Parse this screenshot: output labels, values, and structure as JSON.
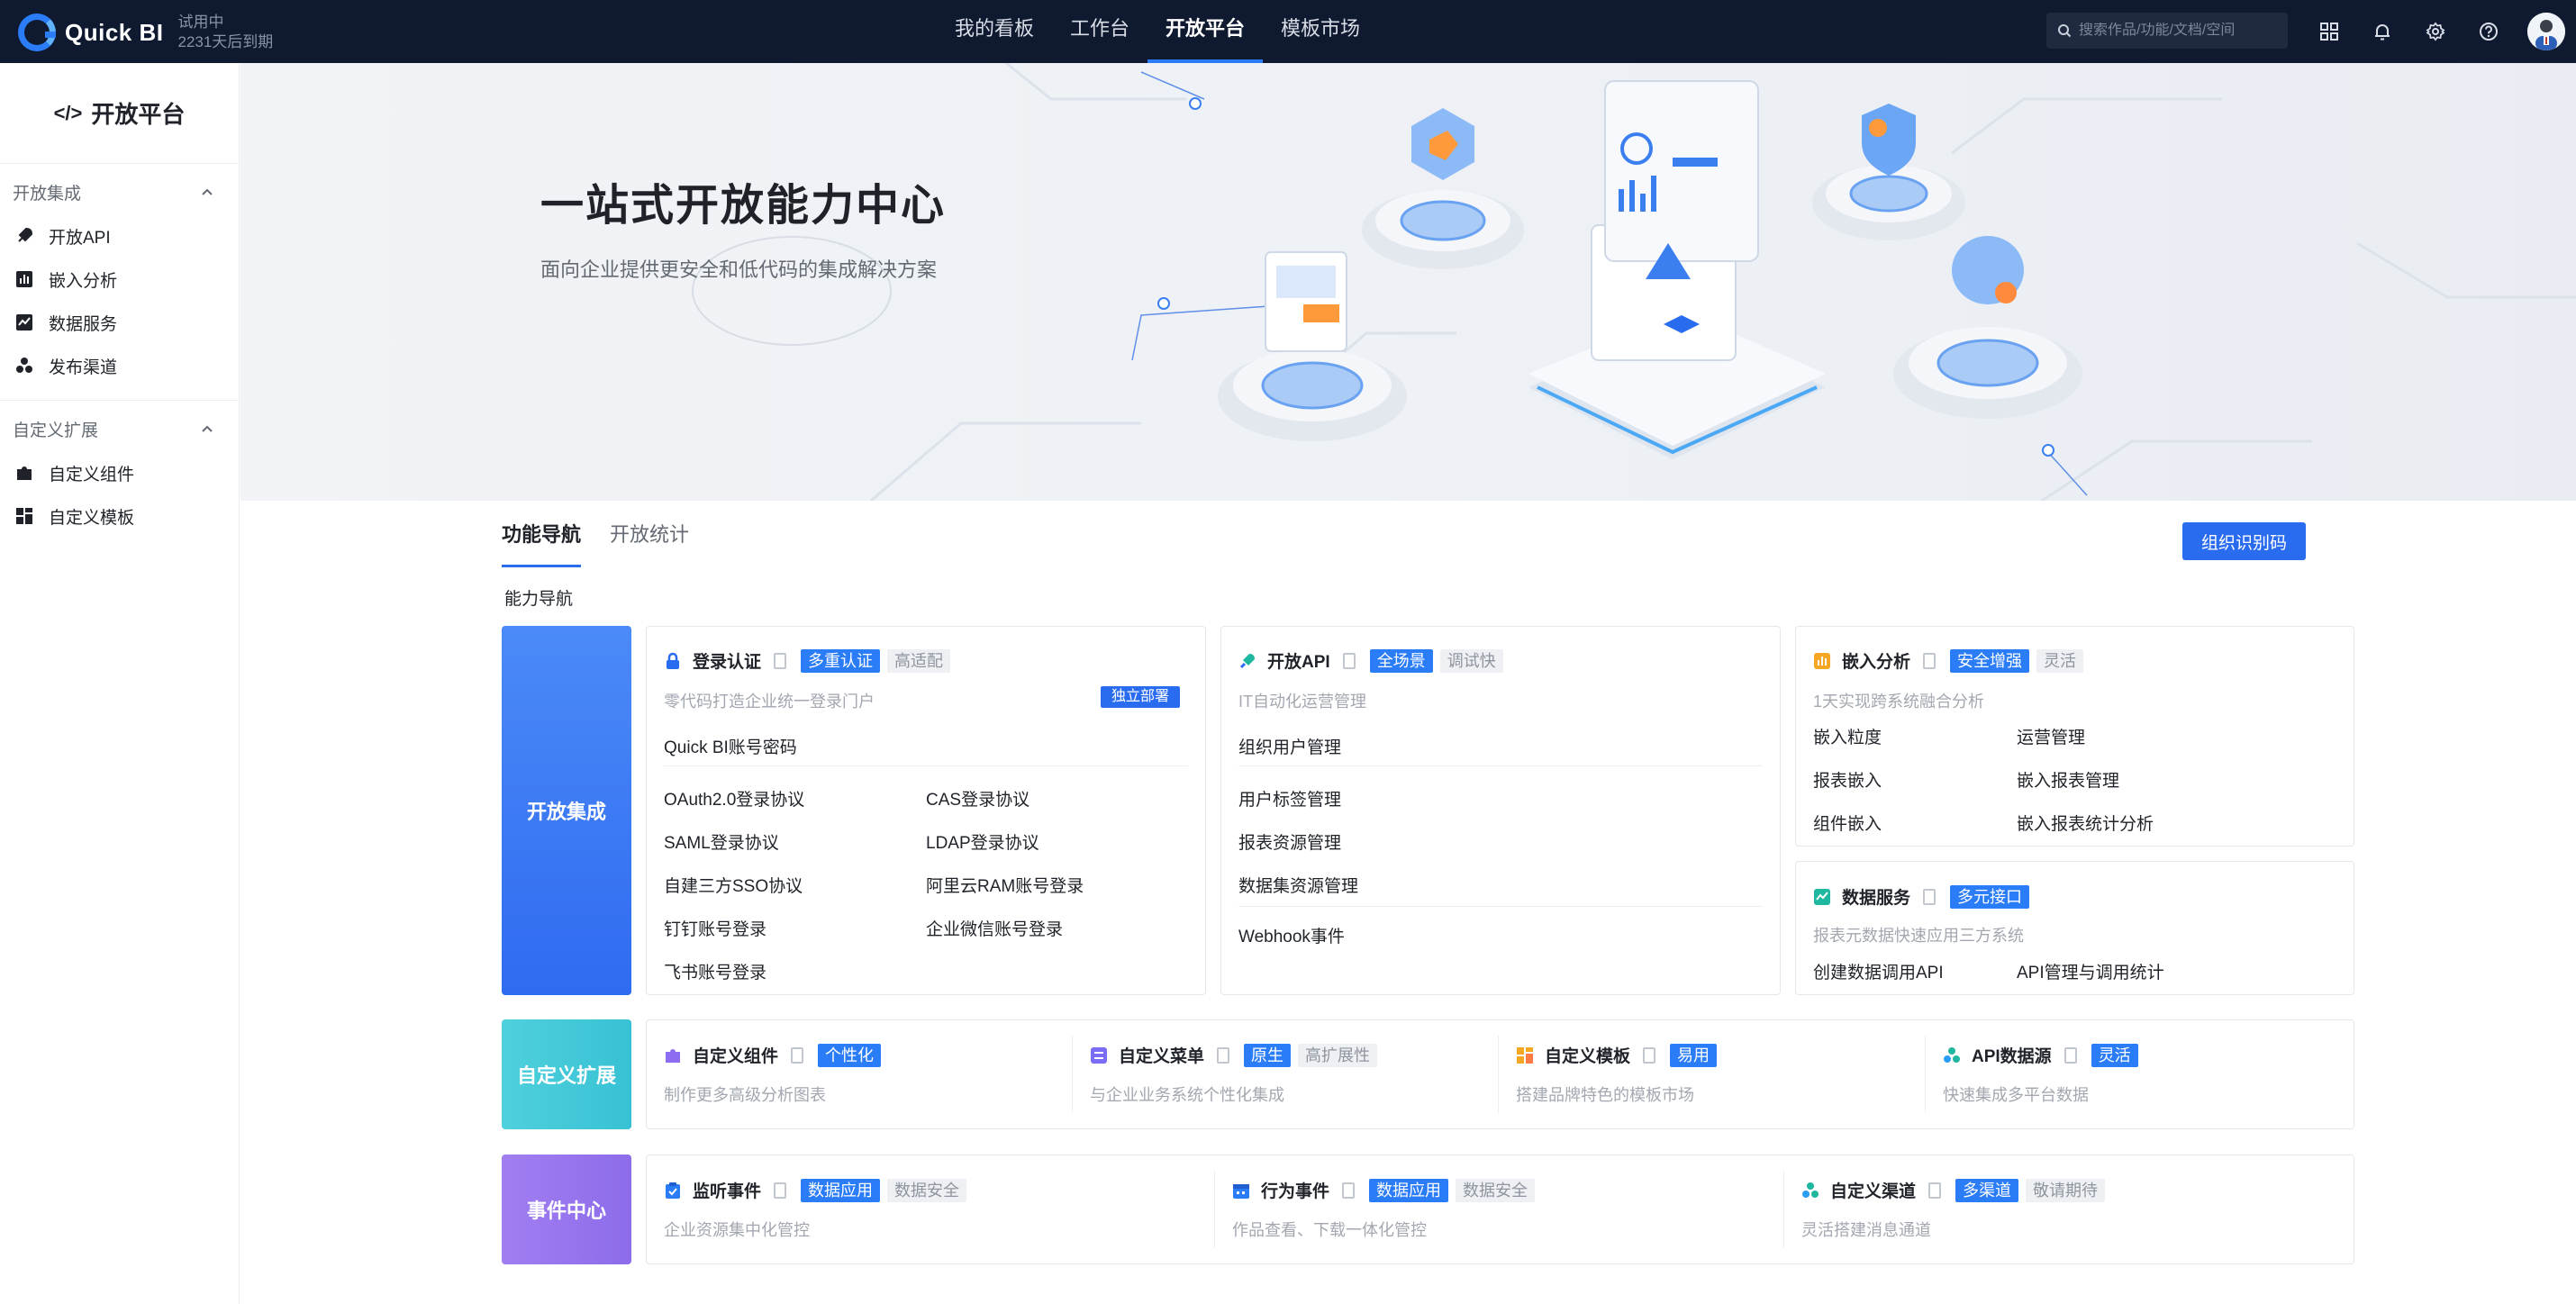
{
  "brand": {
    "name": "Quick BI",
    "trial_status": "试用中",
    "trial_days": "2231天后到期"
  },
  "topnav": {
    "items": [
      "我的看板",
      "工作台",
      "开放平台",
      "模板市场"
    ],
    "active": "开放平台"
  },
  "search": {
    "placeholder": "搜索作品/功能/文档/空间"
  },
  "sidebar": {
    "title": "开放平台",
    "groups": [
      {
        "label": "开放集成",
        "items": [
          "开放API",
          "嵌入分析",
          "数据服务",
          "发布渠道"
        ]
      },
      {
        "label": "自定义扩展",
        "items": [
          "自定义组件",
          "自定义模板"
        ]
      }
    ]
  },
  "banner": {
    "title": "一站式开放能力中心",
    "subtitle": "面向企业提供更安全和低代码的集成解决方案"
  },
  "tabs": [
    "功能导航",
    "开放统计"
  ],
  "org_button": "组织识别码",
  "section_title": "能力导航",
  "rows": {
    "open_integration": {
      "label": "开放集成",
      "login": {
        "title": "登录认证",
        "tags": [
          "多重认证",
          "高适配"
        ],
        "desc": "零代码打造企业统一登录门户",
        "badge": "独立部署",
        "top_link": "Quick BI账号密码",
        "links": [
          "OAuth2.0登录协议",
          "CAS登录协议",
          "SAML登录协议",
          "LDAP登录协议",
          "自建三方SSO协议",
          "阿里云RAM账号登录",
          "钉钉账号登录",
          "企业微信账号登录",
          "飞书账号登录"
        ]
      },
      "api": {
        "title": "开放API",
        "tags": [
          "全场景",
          "调试快"
        ],
        "desc": "IT自动化运营管理",
        "top_link": "组织用户管理",
        "links": [
          "用户标签管理",
          "报表资源管理",
          "数据集资源管理"
        ],
        "bottom_link": "Webhook事件"
      },
      "embed": {
        "title": "嵌入分析",
        "tags": [
          "安全增强",
          "灵活"
        ],
        "desc": "1天实现跨系统融合分析",
        "links": [
          "嵌入粒度",
          "运营管理",
          "报表嵌入",
          "嵌入报表管理",
          "组件嵌入",
          "嵌入报表统计分析"
        ]
      },
      "data_service": {
        "title": "数据服务",
        "tags": [
          "多元接口"
        ],
        "desc": "报表元数据快速应用三方系统",
        "links": [
          "创建数据调用API",
          "API管理与调用统计"
        ]
      }
    },
    "custom_ext": {
      "label": "自定义扩展",
      "items": [
        {
          "title": "自定义组件",
          "tags": [
            "个性化"
          ],
          "desc": "制作更多高级分析图表",
          "color": "#8c6cf0"
        },
        {
          "title": "自定义菜单",
          "tags": [
            "原生",
            "高扩展性"
          ],
          "desc": "与企业业务系统个性化集成",
          "color": "#7b6cf6"
        },
        {
          "title": "自定义模板",
          "tags": [
            "易用"
          ],
          "desc": "搭建品牌特色的模板市场",
          "color": "#f5a623"
        },
        {
          "title": "API数据源",
          "tags": [
            "灵活"
          ],
          "desc": "快速集成多平台数据",
          "color": "#20b7a0"
        }
      ]
    },
    "event_center": {
      "label": "事件中心",
      "items": [
        {
          "title": "监听事件",
          "tags": [
            "数据应用",
            "数据安全"
          ],
          "desc": "企业资源集中化管控",
          "color": "#2a7cf7"
        },
        {
          "title": "行为事件",
          "tags": [
            "数据应用",
            "数据安全"
          ],
          "desc": "作品查看、下载一体化管控",
          "color": "#2a7cf7"
        },
        {
          "title": "自定义渠道",
          "tags": [
            "多渠道",
            "敬请期待"
          ],
          "desc": "灵活搭建消息通道",
          "color": "#20b7a0"
        }
      ]
    }
  }
}
